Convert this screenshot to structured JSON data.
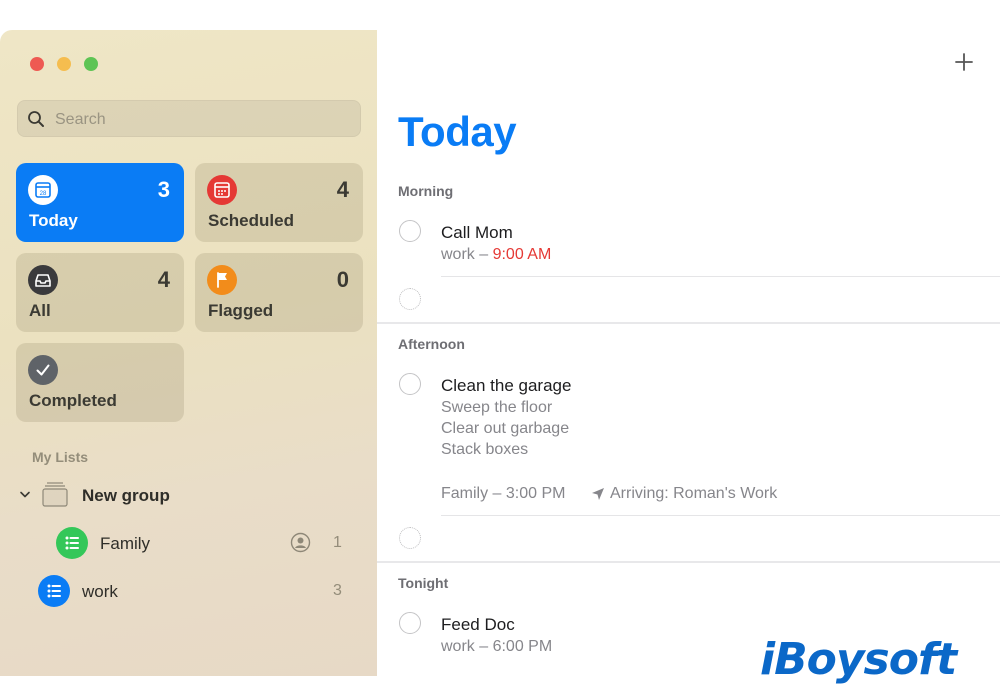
{
  "window": {
    "traffic_lights": {
      "close": "#ee5a52",
      "minimize": "#f5bd4f",
      "zoom": "#5ec454"
    }
  },
  "search": {
    "placeholder": "Search",
    "icon": "search-icon"
  },
  "smart_lists": [
    {
      "label": "Today",
      "count": "3",
      "icon": "calendar-icon",
      "badge": "28",
      "color": "#0a7cf5",
      "selected": true
    },
    {
      "label": "Scheduled",
      "count": "4",
      "icon": "calendar-icon",
      "color": "#e53935",
      "selected": false
    },
    {
      "label": "All",
      "count": "4",
      "icon": "tray-icon",
      "color": "#3a3a3c",
      "selected": false
    },
    {
      "label": "Flagged",
      "count": "0",
      "icon": "flag-icon",
      "color": "#f28c1b",
      "selected": false
    },
    {
      "label": "Completed",
      "icon": "checkmark-icon",
      "color": "#5f6368",
      "selected": false
    }
  ],
  "my_lists": {
    "header": "My Lists",
    "group": {
      "name": "New group",
      "expanded": true
    },
    "lists": [
      {
        "name": "Family",
        "count": "1",
        "color": "#34c759",
        "shared": true
      },
      {
        "name": "work",
        "count": "3",
        "color": "#0a7cf5",
        "shared": false
      }
    ]
  },
  "main": {
    "title": "Today",
    "add_icon": "plus-icon",
    "groups": [
      {
        "label": "Morning",
        "tasks": [
          {
            "title": "Call Mom",
            "list": "work",
            "separator": " – ",
            "time": "9:00 AM",
            "time_color": "#e53935"
          }
        ]
      },
      {
        "label": "Afternoon",
        "tasks": [
          {
            "title": "Clean the garage",
            "subtasks": [
              "Sweep the floor",
              "Clear out garbage",
              "Stack boxes"
            ],
            "list": "Family",
            "separator": " – ",
            "time": "3:00 PM",
            "location_icon": "location-arrow-icon",
            "location": "Arriving: Roman's Work"
          }
        ]
      },
      {
        "label": "Tonight",
        "tasks": [
          {
            "title": "Feed Doc",
            "list": "work",
            "separator": " – ",
            "time": "6:00 PM"
          }
        ]
      }
    ]
  },
  "watermark": {
    "text": "iBoysoft"
  }
}
